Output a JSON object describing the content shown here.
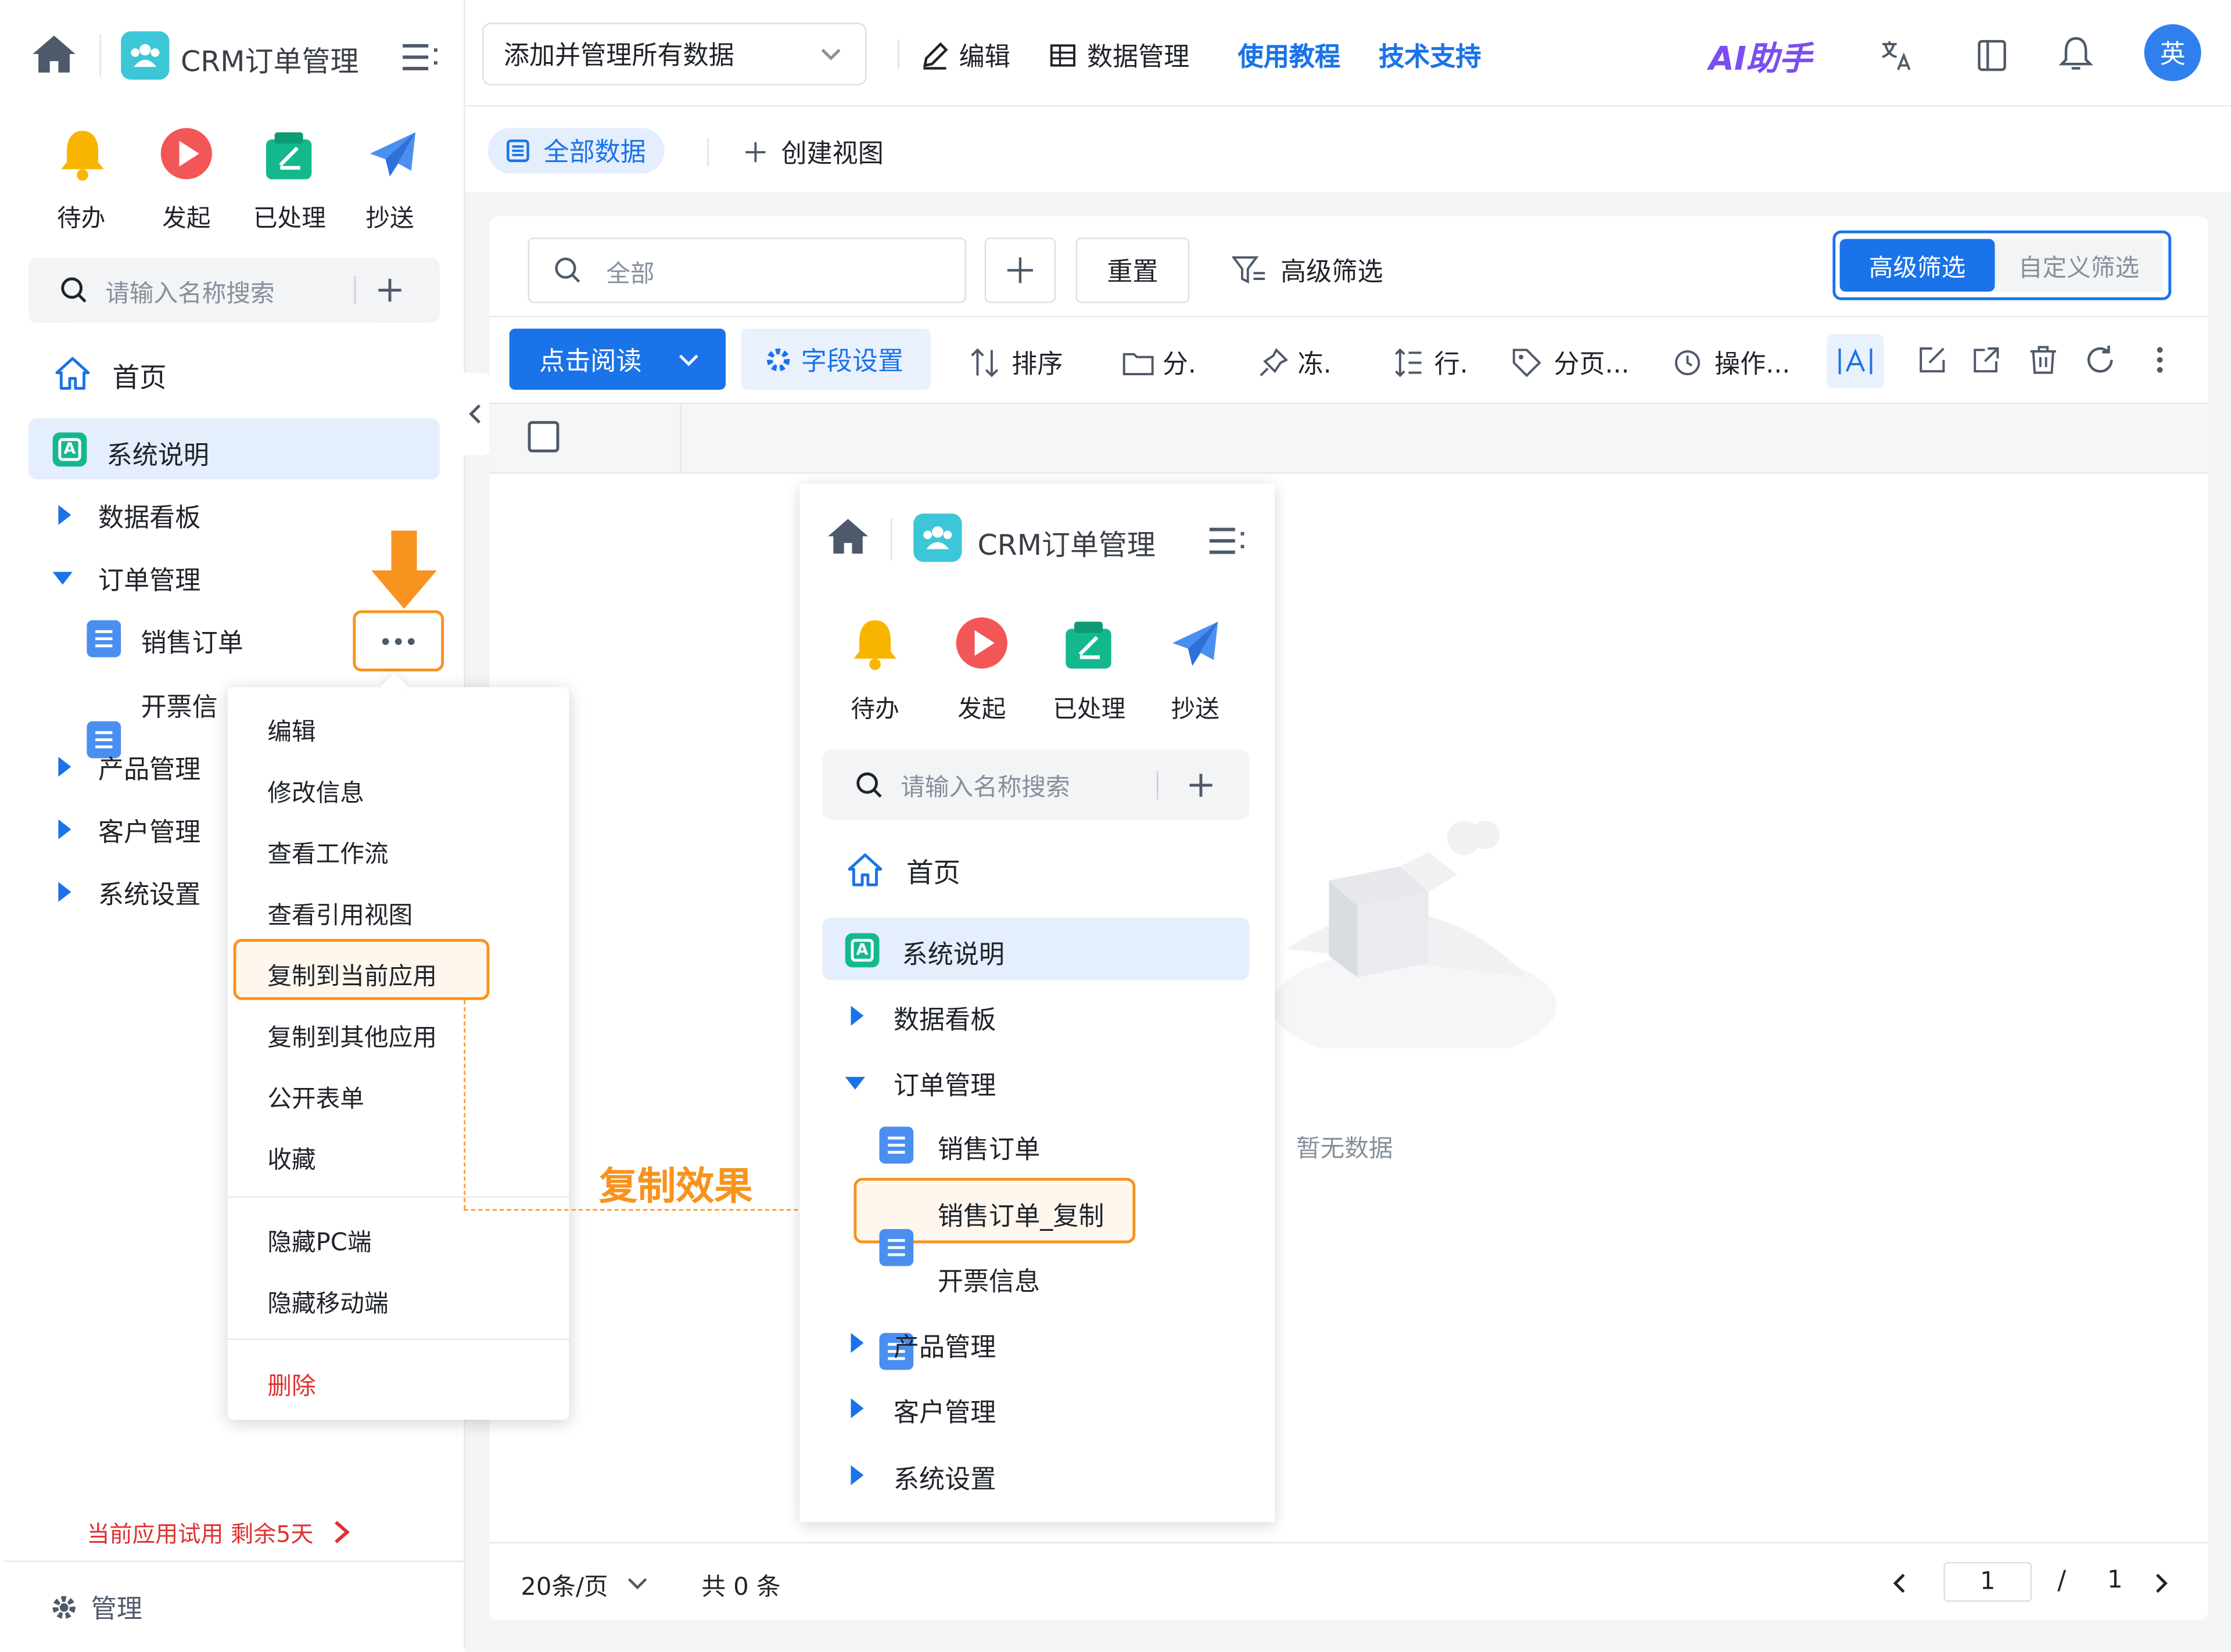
{
  "app": {
    "name": "CRM订单管理",
    "view_select": "添加并管理所有数据",
    "edit": "编辑",
    "data_mgmt": "数据管理",
    "tutorial": "使用教程",
    "support": "技术支持",
    "ai": "AI助手",
    "avatar": "英"
  },
  "quick": [
    "待办",
    "发起",
    "已处理",
    "抄送"
  ],
  "search_placeholder": "请输入名称搜索",
  "nav": {
    "home": "首页",
    "sys_desc": "系统说明",
    "dashboard": "数据看板",
    "order_mgmt": "订单管理",
    "sales_order": "销售订单",
    "invoice": "开票信息",
    "invoice_truncated": "开票信",
    "product": "产品管理",
    "customer": "客户管理",
    "settings": "系统设置",
    "sales_copy": "销售订单_复制"
  },
  "trial": "当前应用试用 剩余5天",
  "manage": "管理",
  "views": {
    "all": "全部数据",
    "create": "创建视图"
  },
  "filter": {
    "search_placeholder": "全部",
    "reset": "重置",
    "advanced": "高级筛选",
    "tab_advanced": "高级筛选",
    "tab_custom": "自定义筛选"
  },
  "toolbar": {
    "read": "点击阅读",
    "fields": "字段设置",
    "sort": "排序",
    "group": "分.",
    "freeze": "冻.",
    "row": "行.",
    "page": "分页...",
    "ops": "操作..."
  },
  "context_menu": [
    "编辑",
    "修改信息",
    "查看工作流",
    "查看引用视图",
    "复制到当前应用",
    "复制到其他应用",
    "公开表单",
    "收藏",
    "隐藏PC端",
    "隐藏移动端",
    "删除"
  ],
  "annotation": "复制效果",
  "empty": "暂无数据",
  "pagination": {
    "per_page": "20条/页",
    "total": "共 0 条",
    "page": "1",
    "sep": "/",
    "pages": "1"
  },
  "colors": {
    "primary": "#1a73e8",
    "accent": "#f7931e",
    "danger": "#e03131"
  },
  "icons": [
    "home-icon",
    "team-icon",
    "menu-icon",
    "bell-icon",
    "play-icon",
    "check-icon",
    "send-icon",
    "search-icon",
    "plus-icon",
    "doc-icon"
  ]
}
